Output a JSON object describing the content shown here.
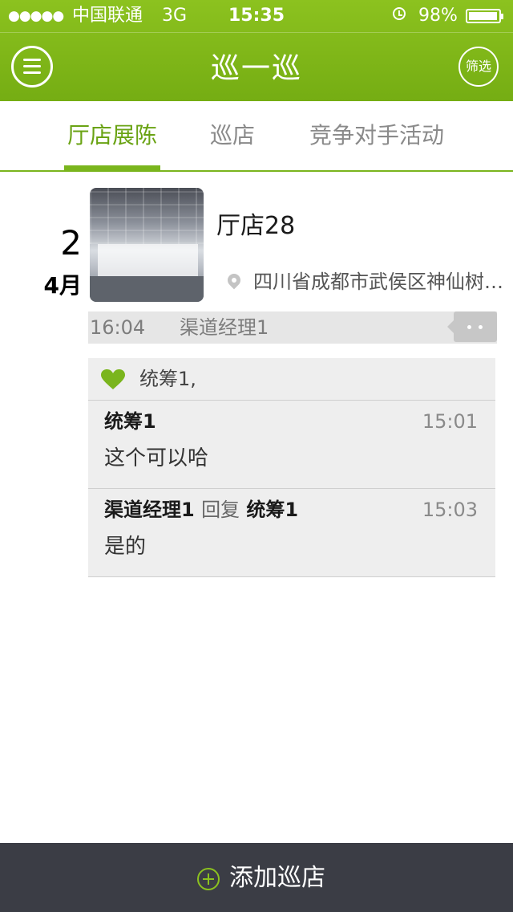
{
  "status_bar": {
    "signal": "●●●●●",
    "carrier": "中国联通",
    "network": "3G",
    "time": "15:35",
    "alarm_icon": "alarm-clock-icon",
    "battery_percent": "98%",
    "battery_level": 0.98
  },
  "nav": {
    "title": "巡一巡",
    "menu_icon": "hamburger-menu-icon",
    "filter_label": "筛选"
  },
  "tabs": [
    {
      "label": "厅店展陈",
      "active": true
    },
    {
      "label": "巡店",
      "active": false
    },
    {
      "label": "竞争对手活动",
      "active": false
    }
  ],
  "post": {
    "day": "2",
    "month": "4月",
    "shop_name": "厅店28",
    "address": "四川省成都市武侯区神仙树…",
    "time": "16:04",
    "user": "渠道经理1",
    "likes": "统筹1,",
    "comments": [
      {
        "author": "统筹1",
        "reply_word": "",
        "reply_to": "",
        "time": "15:01",
        "text": "这个可以哈"
      },
      {
        "author": "渠道经理1",
        "reply_word": "回复",
        "reply_to": "统筹1",
        "time": "15:03",
        "text": "是的"
      }
    ]
  },
  "bottom": {
    "add_label": "添加巡店"
  },
  "colors": {
    "accent": "#7ab51d",
    "header": "#8cc21f",
    "bottom_bar": "#3b3d45"
  }
}
